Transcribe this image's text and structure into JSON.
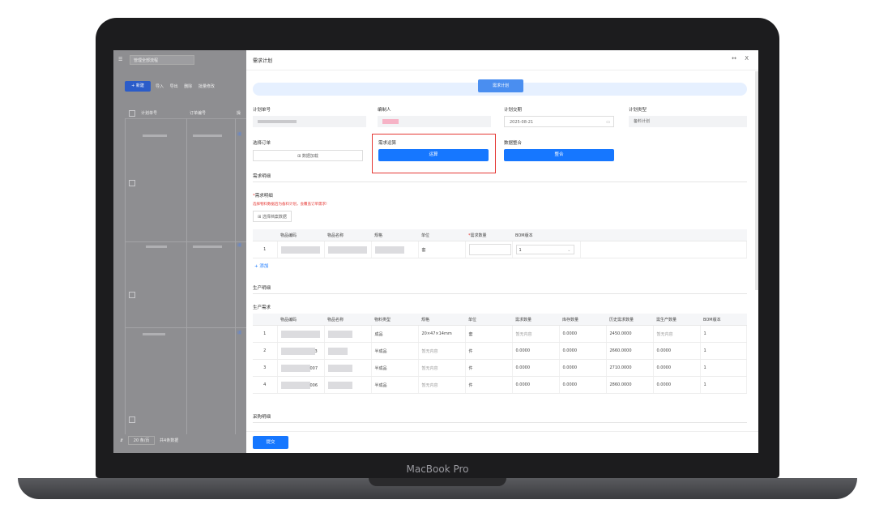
{
  "device": {
    "brand": "MacBook Pro"
  },
  "left_pane": {
    "menu_icon": "menu-icon",
    "scope_select": "管理全部流程",
    "new_button": "+ 新建",
    "tools": [
      "导入",
      "导出",
      "删除",
      "批量修改"
    ],
    "headers": [
      "计划单号",
      "订单编号",
      "操"
    ],
    "link": "编",
    "page_size": "20 条/页",
    "total_text": "共4条数据"
  },
  "drawer": {
    "title": "需求计划",
    "banner_tab": "需求计划",
    "fields": {
      "plan_no_label": "计划单号",
      "editor_label": "编制人",
      "plan_date_label": "计划交期",
      "plan_date_value": "2025-08-21",
      "plan_type_label": "计划类型",
      "plan_type_value": "备料计划",
      "select_order_label": "选择订单",
      "data_load_button": "数据加载",
      "calc_label": "需求运算",
      "calc_button": "运算",
      "merge_label": "数据整合",
      "merge_button": "整合"
    },
    "demand_detail": {
      "section_title": "需求明细",
      "sub_label": "需求明细",
      "hint": "选择物料数据后为备料计划，会覆盖订单需求!",
      "select_button": "选择档案数据",
      "headers": [
        "",
        "物品编码",
        "物品名称",
        "规格",
        "单位",
        "需求数量",
        "BOM版本"
      ],
      "rows": [
        {
          "no": "1",
          "unit": "套",
          "bom": "1"
        }
      ],
      "add_link": "+ 添加"
    },
    "production": {
      "section_title": "生产明细",
      "sub_label": "生产需求",
      "headers": [
        "",
        "物品编码",
        "物品名称",
        "物料类型",
        "规格",
        "单位",
        "需求数量",
        "库存数量",
        "历史需求数量",
        "需生产数量",
        "BOM版本"
      ],
      "rows": [
        {
          "no": "1",
          "code_suffix": "",
          "type": "成品",
          "spec": "20×47×14mm",
          "unit": "套",
          "demand": "暂无内容",
          "stock": "0.0000",
          "history": "2450.0000",
          "produce": "暂无内容",
          "bom": "1"
        },
        {
          "no": "2",
          "code_suffix": "3",
          "type": "半成品",
          "spec": "暂无内容",
          "unit": "件",
          "demand": "0.0000",
          "stock": "0.0000",
          "history": "2660.0000",
          "produce": "0.0000",
          "bom": "1"
        },
        {
          "no": "3",
          "code_suffix": "007",
          "type": "半成品",
          "spec": "暂无内容",
          "unit": "件",
          "demand": "0.0000",
          "stock": "0.0000",
          "history": "2710.0000",
          "produce": "0.0000",
          "bom": "1"
        },
        {
          "no": "4",
          "code_suffix": "006",
          "type": "半成品",
          "spec": "暂无内容",
          "unit": "件",
          "demand": "0.0000",
          "stock": "0.0000",
          "history": "2860.0000",
          "produce": "0.0000",
          "bom": "1"
        }
      ]
    },
    "purchase": {
      "section_title": "采购明细"
    },
    "submit_button": "提交",
    "controls": {
      "expand": "↔",
      "close": "X"
    }
  },
  "colors": {
    "primary": "#1677ff",
    "highlight": "#e53935",
    "banner": "#e6f0ff"
  }
}
